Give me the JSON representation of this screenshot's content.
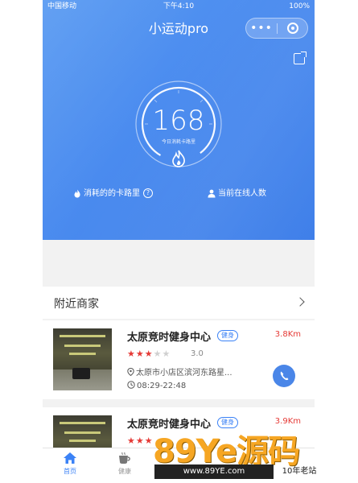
{
  "status_bar": {
    "carrier": "中国移动",
    "time": "下午4:10",
    "battery": "100%"
  },
  "navbar": {
    "title": "小运动pro"
  },
  "hero": {
    "gauge_value": "168",
    "gauge_caption": "今日消耗卡路里",
    "metric_left": "消耗的的卡路里",
    "metric_right": "当前在线人数",
    "help_icon": "?"
  },
  "nearby": {
    "title": "附近商家"
  },
  "merchants": [
    {
      "name": "太原竞时健身中心",
      "badge": "健身",
      "distance": "3.8Km",
      "rating_stars": 3,
      "rating_max": 5,
      "rating_text": "3.0",
      "address": "太原市小店区滨河东路星...",
      "hours": "08:29-22:48"
    },
    {
      "name": "太原竞时健身中心",
      "badge": "健身",
      "distance": "3.9Km"
    }
  ],
  "tabbar": {
    "tabs": [
      {
        "label": "首页",
        "icon": "home-icon"
      },
      {
        "label": "健康",
        "icon": "coffee-icon"
      }
    ]
  },
  "watermark": {
    "brand": "89Ye源码",
    "url": "www.89YE.com",
    "tag": "10年老站"
  },
  "colors": {
    "primary": "#4a8bef",
    "accent_red": "#e53935",
    "tab_active": "#3b82f6"
  }
}
